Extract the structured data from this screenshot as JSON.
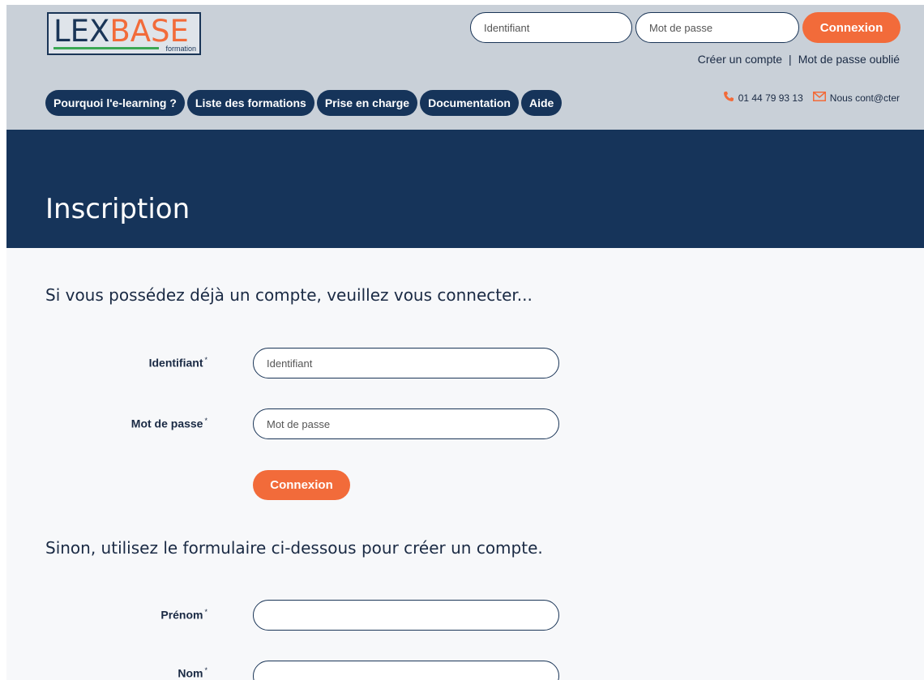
{
  "logo": {
    "part1": "LEX",
    "part2": "BASE",
    "sub": "formation"
  },
  "top_login": {
    "username_placeholder": "Identifiant",
    "password_placeholder": "Mot de passe",
    "button_label": "Connexion"
  },
  "account_links": {
    "create": "Créer un compte",
    "separator": "|",
    "forgot": "Mot de passe oublié"
  },
  "nav": {
    "items": [
      {
        "label": "Pourquoi l'e-learning ?"
      },
      {
        "label": "Liste des formations"
      },
      {
        "label": "Prise en charge"
      },
      {
        "label": "Documentation"
      },
      {
        "label": "Aide"
      }
    ]
  },
  "contact": {
    "phone": "01 44 79 93 13",
    "email_label": "Nous cont@cter"
  },
  "banner": {
    "title": "Inscription"
  },
  "login_section": {
    "intro": "Si vous possédez déjà un compte, veuillez vous connecter...",
    "username_label": "Identifiant",
    "username_placeholder": "Identifiant",
    "password_label": "Mot de passe",
    "password_placeholder": "Mot de passe",
    "required_marker": "*",
    "button_label": "Connexion"
  },
  "register_section": {
    "intro": "Sinon, utilisez le formulaire ci-dessous pour créer un compte.",
    "firstname_label": "Prénom",
    "lastname_label": "Nom",
    "required_marker": "*"
  },
  "colors": {
    "header_bg": "#c9d0d8",
    "navy": "#16345a",
    "accent_orange": "#f26b3a",
    "logo_green": "#3aa853"
  }
}
